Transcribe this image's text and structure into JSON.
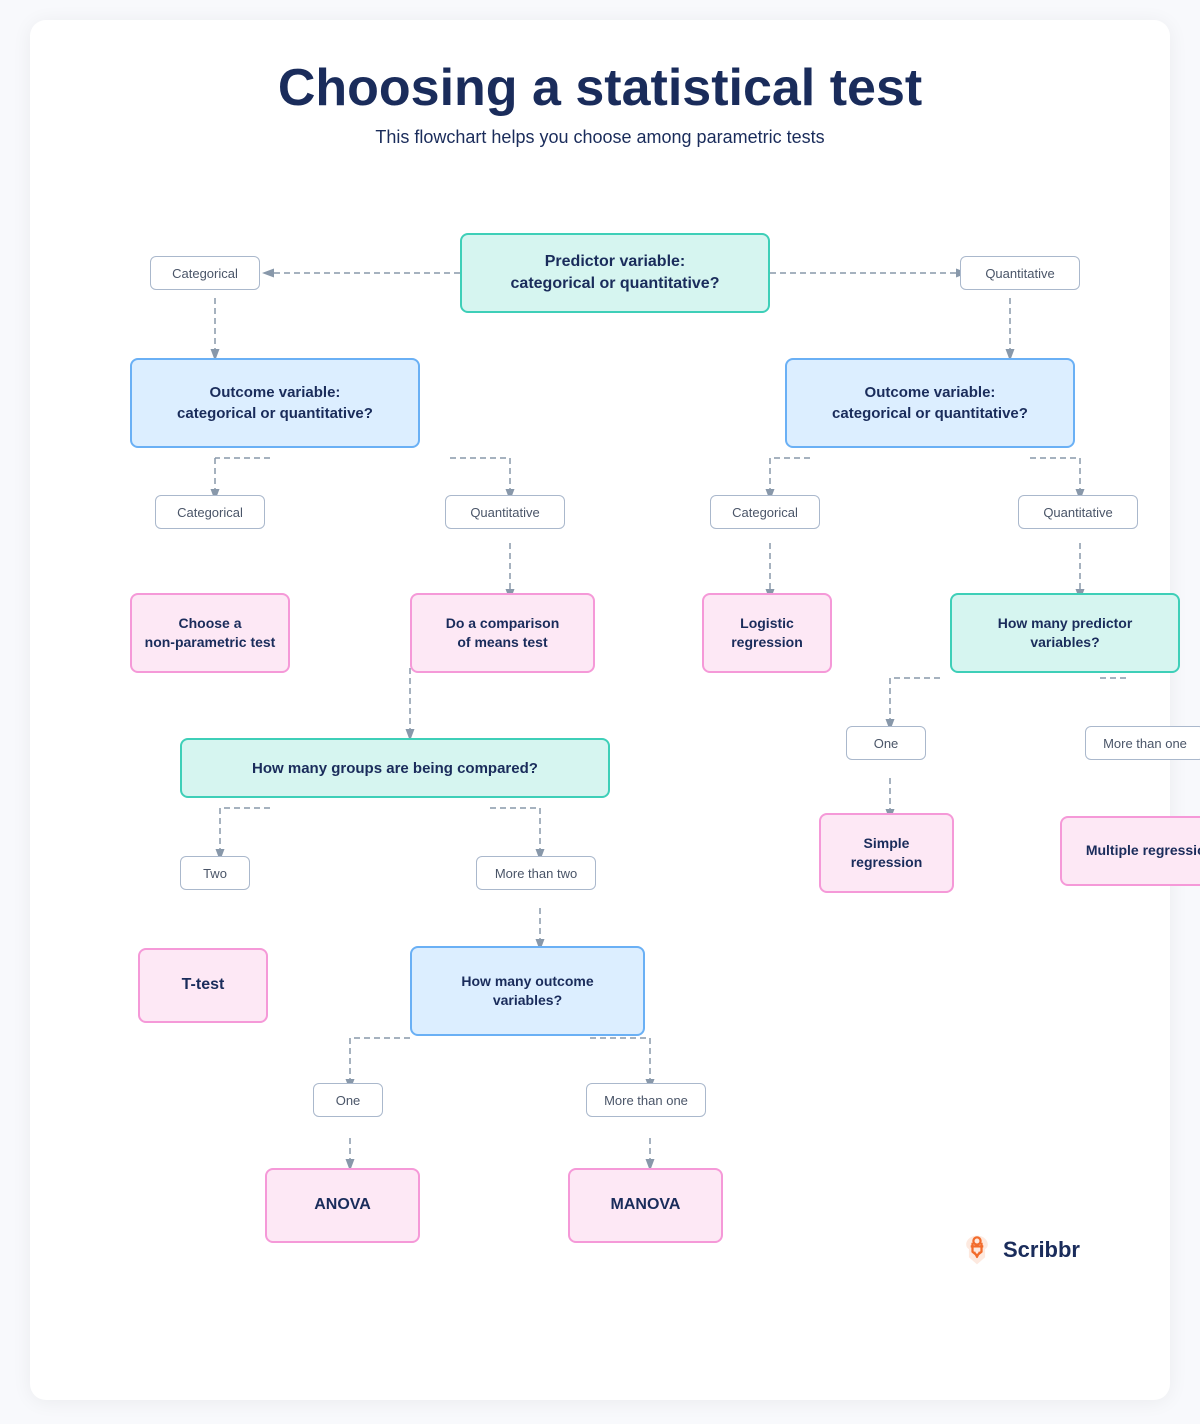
{
  "title": "Choosing a statistical test",
  "subtitle": "This flowchart helps you choose among parametric tests",
  "boxes": {
    "predictor": "Predictor variable:\ncategorical or quantitative?",
    "outcome_left": "Outcome variable:\ncategorical or quantitative?",
    "outcome_right": "Outcome variable:\ncategorical or quantitative?",
    "non_parametric": "Choose a\nnon-parametric test",
    "comparison_means": "Do a comparison\nof means test",
    "how_many_groups": "How many groups are being compared?",
    "t_test": "T-test",
    "how_many_outcome": "How many outcome\nvariables?",
    "anova": "ANOVA",
    "manova": "MANOVA",
    "logistic": "Logistic\nregression",
    "how_many_predictor": "How many predictor\nvariables?",
    "simple_regression": "Simple\nregression",
    "multiple_regression": "Multiple regression"
  },
  "labels": {
    "categorical_top_left": "Categorical",
    "quantitative_top_right": "Quantitative",
    "categorical_left": "Categorical",
    "quantitative_left": "Quantitative",
    "categorical_right": "Categorical",
    "quantitative_right": "Quantitative",
    "two": "Two",
    "more_than_two": "More than two",
    "one_left": "One",
    "more_than_one_left": "More than one",
    "one_right": "One",
    "more_than_one_right": "More than one"
  },
  "brand": {
    "name": "Scribbr"
  }
}
